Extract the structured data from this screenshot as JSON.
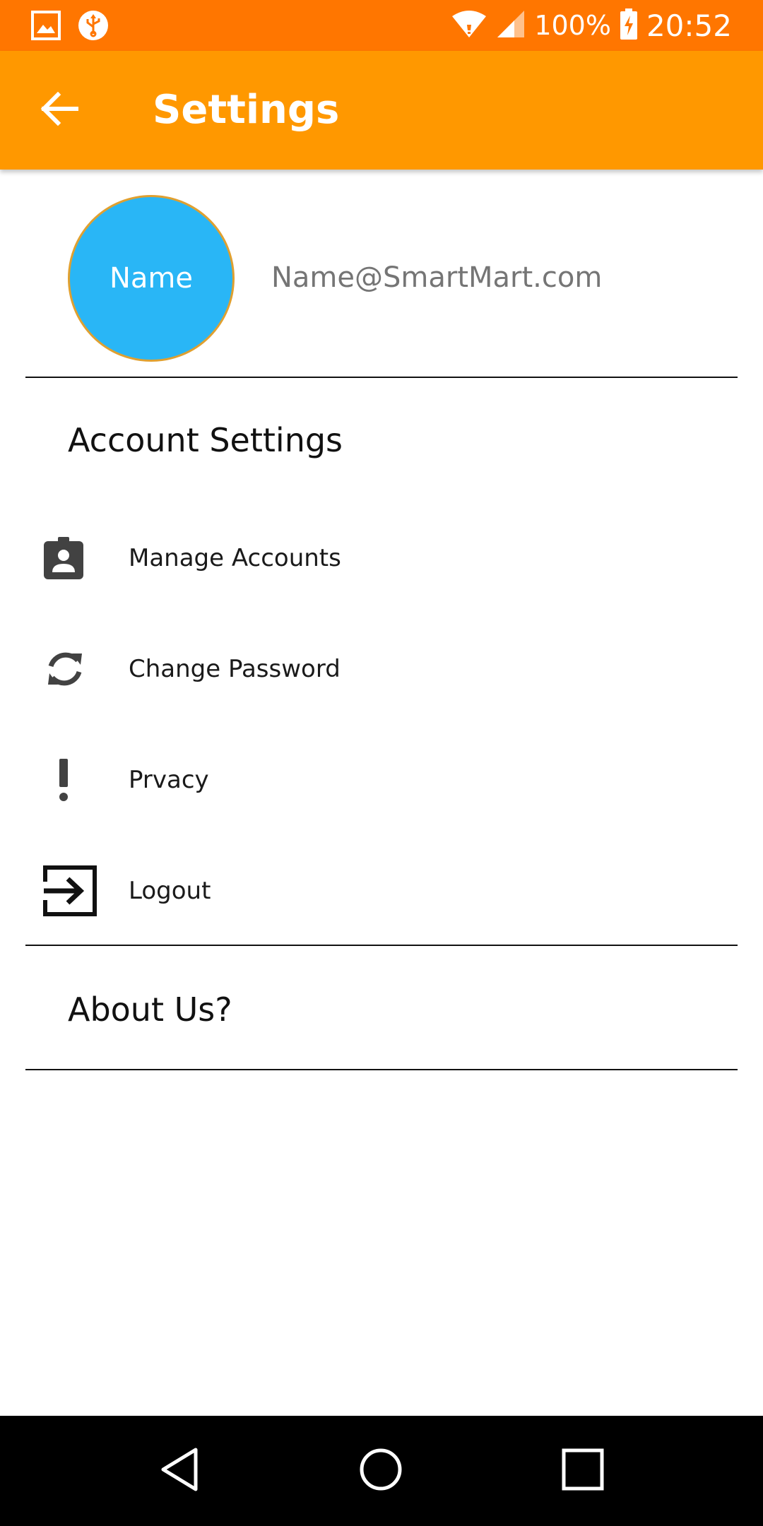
{
  "status_bar": {
    "battery": "100%",
    "time": "20:52",
    "icons": [
      "gallery-icon",
      "usb-icon",
      "wifi-icon",
      "signal-icon",
      "battery-charging-icon"
    ]
  },
  "app_bar": {
    "title": "Settings",
    "back_icon": "arrow-back-icon"
  },
  "profile": {
    "avatar_label": "Name",
    "email": "Name@SmartMart.com"
  },
  "sections": {
    "account_title": "Account Settings",
    "about_title": "About Us?"
  },
  "menu": [
    {
      "label": "Manage Accounts",
      "icon": "account-box-icon"
    },
    {
      "label": "Change Password",
      "icon": "sync-icon"
    },
    {
      "label": "Prvacy",
      "icon": "exclamation-icon"
    },
    {
      "label": "Logout",
      "icon": "exit-icon"
    }
  ],
  "nav_bar": {
    "icons": [
      "nav-back-icon",
      "nav-home-icon",
      "nav-recents-icon"
    ]
  },
  "colors": {
    "status_bar": "#ff7600",
    "app_bar": "#ff9800",
    "avatar": "#29b6f6",
    "avatar_border": "#e0a030"
  }
}
